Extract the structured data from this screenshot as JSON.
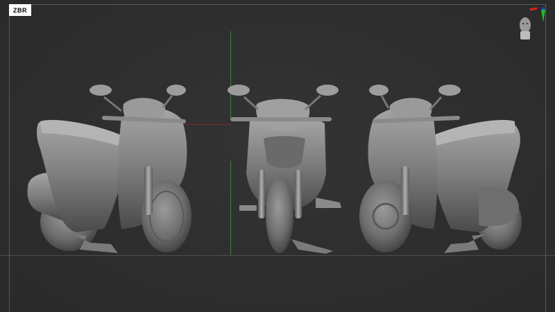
{
  "app": {
    "logo_text": "ZBR"
  },
  "gizmo": {
    "icon": "head-orientation-icon",
    "x_color": "#e02020",
    "y_color": "#20c020",
    "z_color": "#2040e0"
  },
  "guides": {
    "vertical_axis_color": "#2f8a3a",
    "horizontal_axis_color": "#7a2a2a",
    "frame_color": "#5a5a5a"
  },
  "model": {
    "views": [
      "side-left",
      "front",
      "side-right"
    ],
    "material_color": "#8c8c8c"
  }
}
